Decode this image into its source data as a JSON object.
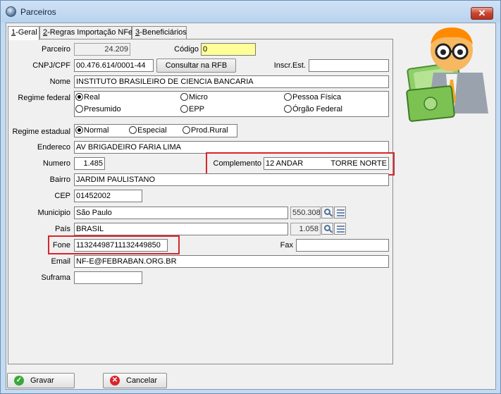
{
  "window": {
    "title": "Parceiros",
    "close_symbol": "✕"
  },
  "tabs": [
    {
      "accel": "1",
      "label": "-Geral",
      "active": true
    },
    {
      "accel": "2",
      "label": "-Regras Importação NFe",
      "active": false
    },
    {
      "accel": "3",
      "label": "-Beneficiários",
      "active": false
    }
  ],
  "form": {
    "parceiro": {
      "label": "Parceiro",
      "value": "24.209"
    },
    "codigo": {
      "label": "Código",
      "value": "0"
    },
    "cnpj": {
      "label": "CNPJ/CPF",
      "value": "00.476.614/0001-44"
    },
    "consultar_label": "Consultar na RFB",
    "inscr": {
      "label": "Inscr.Est.",
      "value": ""
    },
    "nome": {
      "label": "Nome",
      "value": "INSTITUTO BRASILEIRO DE CIENCIA BANCARIA"
    },
    "regime_federal": {
      "label": "Regime federal",
      "options": [
        "Real",
        "Micro",
        "Pessoa Física",
        "Presumido",
        "EPP",
        "Órgão Federal"
      ],
      "selected": "Real"
    },
    "regime_estadual": {
      "label": "Regime estadual",
      "options": [
        "Normal",
        "Especial",
        "Prod.Rural"
      ],
      "selected": "Normal"
    },
    "endereco": {
      "label": "Endereco",
      "value": "AV BRIGADEIRO FARIA LIMA"
    },
    "numero": {
      "label": "Numero",
      "value": "1.485"
    },
    "complemento": {
      "label": "Complemento",
      "value": "12 ANDAR",
      "value2": "TORRE NORTE"
    },
    "bairro": {
      "label": "Bairro",
      "value": "JARDIM PAULISTANO"
    },
    "cep": {
      "label": "CEP",
      "value": "01452002"
    },
    "municipio": {
      "label": "Municipio",
      "value": "São Paulo",
      "code": "550.308"
    },
    "pais": {
      "label": "País",
      "value": "BRASIL",
      "code": "1.058"
    },
    "fone": {
      "label": "Fone",
      "value": "11324498711132449850"
    },
    "fax": {
      "label": "Fax",
      "value": ""
    },
    "email": {
      "label": "Email",
      "value": "NF-E@FEBRABAN.ORG.BR"
    },
    "suframa": {
      "label": "Suframa",
      "value": ""
    }
  },
  "buttons": {
    "gravar": "Gravar",
    "cancelar": "Cancelar"
  },
  "colors": {
    "highlight": "#d9252a",
    "codigo_bg": "#ffff99",
    "gravar_icon": "#3aa83a",
    "cancelar_icon": "#d9252a"
  },
  "icons": [
    "app-icon",
    "close-icon",
    "search-icon",
    "list-icon",
    "check-icon",
    "cancel-icon",
    "user-mascot-icon"
  ]
}
